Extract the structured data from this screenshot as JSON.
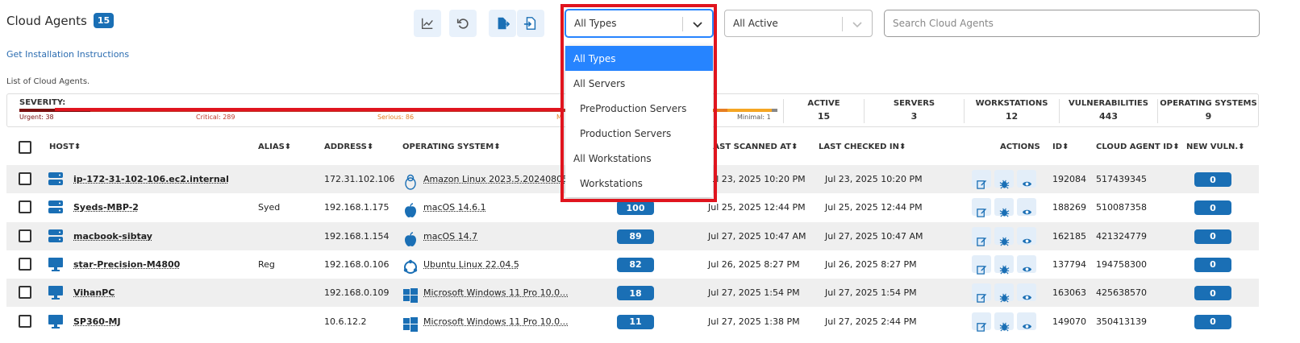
{
  "header": {
    "title": "Cloud Agents",
    "count": "15",
    "install_link": "Get Installation Instructions",
    "subtitle": "List of Cloud Agents."
  },
  "toolbar": {
    "icons": [
      "chart-icon",
      "refresh-icon",
      "export-icon",
      "import-icon"
    ]
  },
  "filters": {
    "type_value": "All Types",
    "status_value": "All Active",
    "search_placeholder": "Search Cloud Agents",
    "type_options": [
      {
        "label": "All Types",
        "selected": true
      },
      {
        "label": "All Servers",
        "selected": false
      },
      {
        "label": "PreProduction Servers",
        "selected": false
      },
      {
        "label": "Production Servers",
        "selected": false
      },
      {
        "label": "All Workstations",
        "selected": false
      },
      {
        "label": "Workstations",
        "selected": false
      }
    ]
  },
  "summary": {
    "severity_label": "SEVERITY:",
    "urgent": "Urgent: 38",
    "critical": "Critical: 289",
    "serious": "Serious: 86",
    "medium": "M",
    "minimal": "Minimal: 1",
    "stats": [
      {
        "key": "ACTIVE",
        "value": "15"
      },
      {
        "key": "SERVERS",
        "value": "3"
      },
      {
        "key": "WORKSTATIONS",
        "value": "12"
      },
      {
        "key": "VULNERABILITIES",
        "value": "443"
      },
      {
        "key": "OPERATING SYSTEMS",
        "value": "9"
      }
    ]
  },
  "table": {
    "headers": {
      "host": "HOST",
      "alias": "ALIAS",
      "address": "ADDRESS",
      "os": "OPERATING SYSTEM",
      "last_scanned": "LAST SCANNED AT",
      "last_checked": "LAST CHECKED IN",
      "actions": "ACTIONS",
      "id": "ID",
      "agent_id": "CLOUD AGENT ID",
      "new_vuln": "NEW VULN."
    },
    "rows": [
      {
        "host": "ip-172-31-102-106.ec2.internal",
        "type": "server",
        "alias": "",
        "address": "172.31.102.106",
        "os": "Amazon Linux 2023.5.20240805",
        "os_icon": "linux-icon",
        "vulns": "",
        "scanned": "Jul 23, 2025 10:20 PM",
        "checked": "Jul 23, 2025 10:20 PM",
        "id": "192084",
        "agent_id": "517439345",
        "new": "0"
      },
      {
        "host": "Syeds-MBP-2",
        "type": "server",
        "alias": "Syed",
        "address": "192.168.1.175",
        "os": "macOS 14.6.1",
        "os_icon": "apple-icon",
        "vulns": "100",
        "scanned": "Jul 25, 2025 12:44 PM",
        "checked": "Jul 25, 2025 12:44 PM",
        "id": "188269",
        "agent_id": "510087358",
        "new": "0"
      },
      {
        "host": "macbook-sibtay",
        "type": "server",
        "alias": "",
        "address": "192.168.1.154",
        "os": "macOS 14.7",
        "os_icon": "apple-icon",
        "vulns": "89",
        "scanned": "Jul 27, 2025 10:47 AM",
        "checked": "Jul 27, 2025 10:47 AM",
        "id": "162185",
        "agent_id": "421324779",
        "new": "0"
      },
      {
        "host": "star-Precision-M4800",
        "type": "workstation",
        "alias": "Reg",
        "address": "192.168.0.106",
        "os": "Ubuntu Linux 22.04.5",
        "os_icon": "ubuntu-icon",
        "vulns": "82",
        "scanned": "Jul 26, 2025 8:27 PM",
        "checked": "Jul 26, 2025 8:27 PM",
        "id": "137794",
        "agent_id": "194758300",
        "new": "0"
      },
      {
        "host": "VihanPC",
        "type": "workstation",
        "alias": "",
        "address": "192.168.0.109",
        "os": "Microsoft Windows 11 Pro 10.0...",
        "os_icon": "windows-icon",
        "vulns": "18",
        "scanned": "Jul 27, 2025 1:54 PM",
        "checked": "Jul 27, 2025 1:54 PM",
        "id": "163063",
        "agent_id": "425638570",
        "new": "0"
      },
      {
        "host": "SP360-MJ",
        "type": "workstation",
        "alias": "",
        "address": "10.6.12.2",
        "os": "Microsoft Windows 11 Pro 10.0...",
        "os_icon": "windows-icon",
        "vulns": "11",
        "scanned": "Jul 27, 2025 1:38 PM",
        "checked": "Jul 27, 2025 2:44 PM",
        "id": "149070",
        "agent_id": "350413139",
        "new": "0"
      }
    ]
  },
  "colors": {
    "accent": "#1a6fb5",
    "select_focus": "#2684ff",
    "highlight": "#e0141e"
  }
}
